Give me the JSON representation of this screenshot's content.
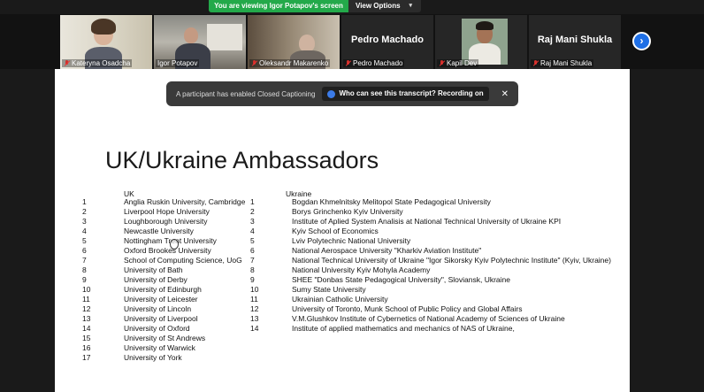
{
  "banner": {
    "message": "You are viewing Igor Potapov's screen",
    "options_label": "View Options"
  },
  "participants": [
    {
      "name": "Kateryna Osadcha",
      "video": true
    },
    {
      "name": "Igor Potapov",
      "video": true
    },
    {
      "name": "Oleksandr Makarenko",
      "video": true
    },
    {
      "name": "Pedro Machado",
      "video": false
    },
    {
      "name": "Kapil Dev",
      "video": true
    },
    {
      "name": "Raj Mani Shukla",
      "video": false
    }
  ],
  "cc": {
    "notice": "A participant has enabled Closed Captioning",
    "question": "Who can see this transcript? Recording on"
  },
  "slide": {
    "title": "UK/Ukraine Ambassadors",
    "uk_header": "UK",
    "ua_header": "Ukraine",
    "uk_numbers": [
      "1",
      "2",
      "3",
      "4",
      "5",
      "6",
      "7",
      "8",
      "9",
      "10",
      "11",
      "12",
      "13",
      "14",
      "15",
      "16",
      "17"
    ],
    "uk": [
      "Anglia Ruskin University, Cambridge",
      "Liverpool Hope University",
      "Loughborough University",
      "Newcastle University",
      "Nottingham Trent University",
      "Oxford Brookes University",
      "School of Computing Science, UoG",
      "University of Bath",
      "University of Derby",
      "University of Edinburgh",
      "University of Leicester",
      "University of Lincoln",
      "University of Liverpool",
      "University of Oxford",
      "University of St Andrews",
      "University of Warwick",
      "University of York"
    ],
    "ua_numbers": [
      "1",
      "2",
      "3",
      "4",
      "5",
      "6",
      "7",
      "8",
      "9",
      "10",
      "11",
      "12",
      "13",
      "14"
    ],
    "ua": [
      "Bogdan Khmelnitsky Melitopol State Pedagogical University",
      "Borys Grinchenko Kyiv University",
      "Institute of Aplied System Analisis at National Technical University of Ukraine KPI",
      "Kyiv School of Economics",
      "Lviv Polytechnic National University",
      "National Aerospace University \"Kharkiv Aviation Institute\"",
      "National Technical University of Ukraine \"Igor Sikorsky Kyiv Polytechnic Institute\" (Kyiv, Ukraine)",
      "National University Kyiv Mohyla Academy",
      "SHEE \"Donbas State Pedagogical University\",  Sloviansk, Ukraine",
      "Sumy State University",
      "Ukrainian Catholic University",
      "University of Toronto, Munk School of Public Policy and Global Affairs",
      "V.M.Glushkov Institute of Cybernetics of National Academy of Sciences of Ukraine",
      "Institute of applied mathematics and mechanics of NAS of Ukraine,"
    ]
  }
}
